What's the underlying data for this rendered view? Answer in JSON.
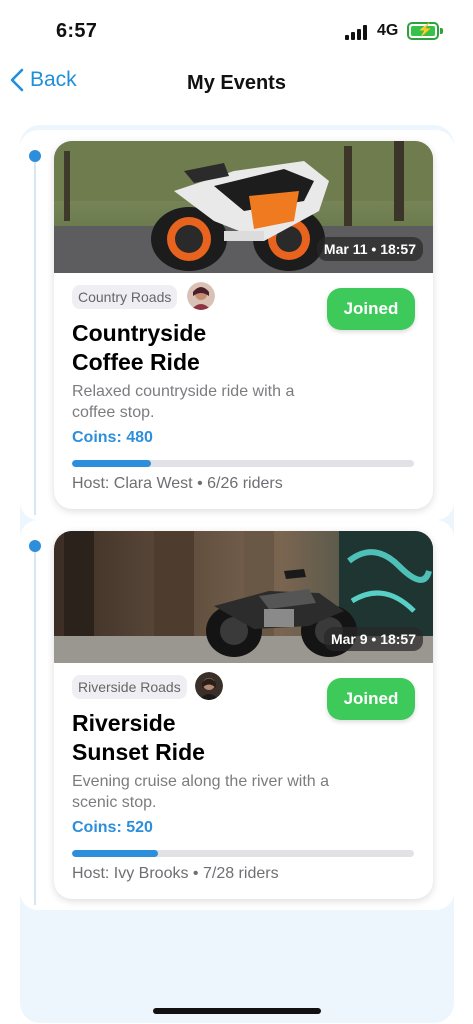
{
  "status": {
    "time": "6:57",
    "network": "4G",
    "battery_level": 0.75
  },
  "nav": {
    "back_label": "Back",
    "title": "My Events"
  },
  "events": [
    {
      "date": "Mar 11 • 18:57",
      "region": "Country Roads",
      "status": "Joined",
      "title_line1": "Countryside",
      "title_line2": "Coffee Ride",
      "description": "Relaxed countryside ride with a coffee stop.",
      "coins": "Coins: 480",
      "progress": 0.23,
      "host": "Host: Clara West • 6/26 riders"
    },
    {
      "date": "Mar 9 • 18:57",
      "region": "Riverside Roads",
      "status": "Joined",
      "title_line1": "Riverside",
      "title_line2": "Sunset Ride",
      "description": "Evening cruise along the river with a scenic stop.",
      "coins": "Coins: 520",
      "progress": 0.25,
      "host": "Host: Ivy Brooks • 7/28 riders"
    }
  ],
  "colors": {
    "accent": "#2d8fdb",
    "joined": "#3ec95b",
    "back": "#1f8fdc"
  }
}
